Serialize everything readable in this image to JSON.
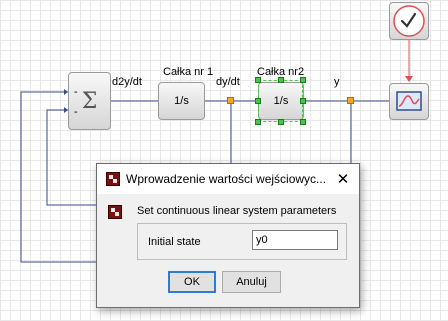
{
  "diagram": {
    "labels": {
      "sum_out": "d2y/dt",
      "integrator1_title": "Całka nr 1",
      "integrator1_out": "dy/dt",
      "integrator2_title": "Całka nr2",
      "output": "y"
    },
    "blocks": {
      "integrator1": "1/s",
      "integrator2": "1/s",
      "sum_symbol": "Σ",
      "sum_minus_top": "-",
      "sum_minus_bottom": "-"
    }
  },
  "dialog": {
    "title": "Wprowadzenie wartości wejściowyc...",
    "close": "✕",
    "heading": "Set continuous linear system parameters",
    "field_label": "Initial state",
    "field_value": "y0",
    "ok_label": "OK",
    "cancel_label": "Anuluj"
  },
  "colors": {
    "link": "#3a4a8a",
    "clock_link": "#e05050",
    "port": "#f5a623",
    "selection": "#46c846"
  }
}
